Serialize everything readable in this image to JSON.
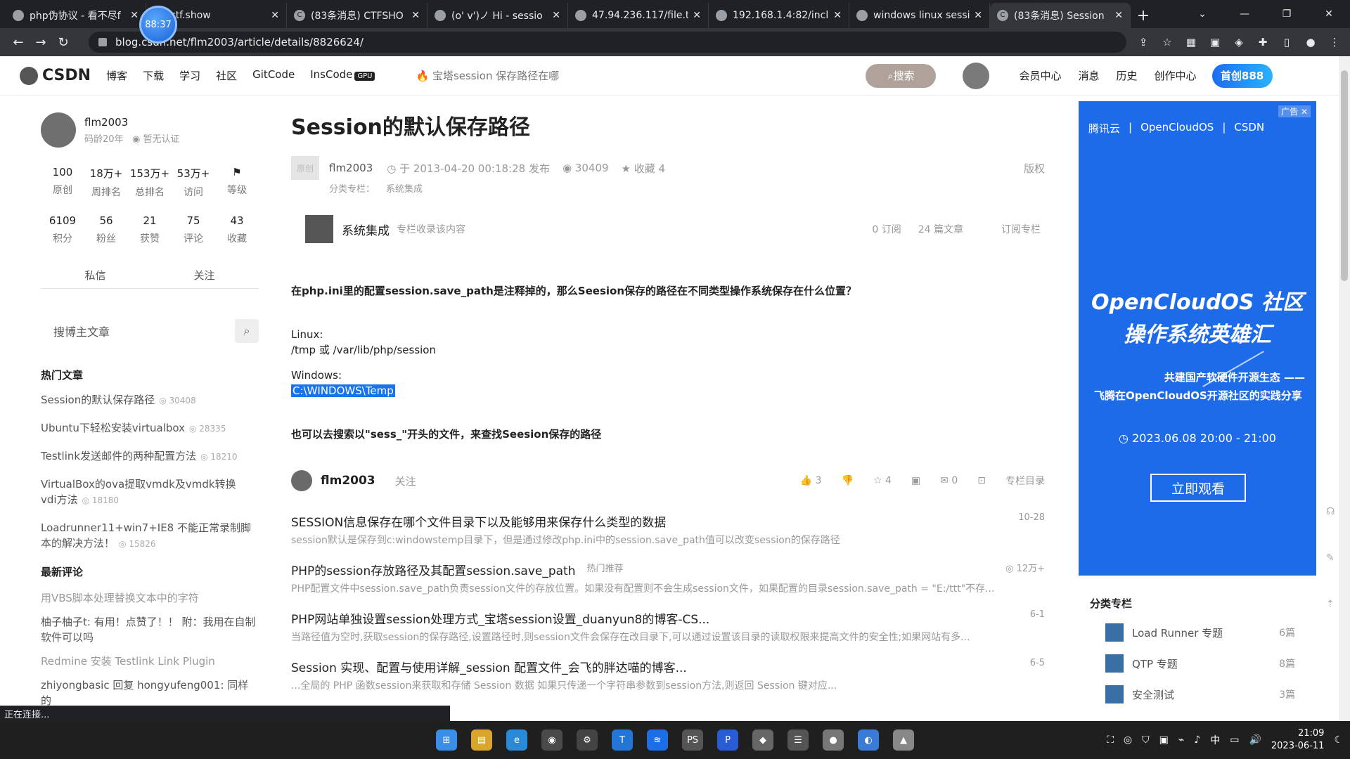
{
  "browser": {
    "tabs": [
      {
        "title": "php伪协议 - 看不尽f",
        "active": false
      },
      {
        "title": "ctf.show",
        "active": false
      },
      {
        "title": "(83条消息) CTFSHO",
        "active": false
      },
      {
        "title": "(o' v')ノ Hi - sessio",
        "active": false
      },
      {
        "title": "47.94.236.117/file.t",
        "active": false
      },
      {
        "title": "192.168.1.4:82/inclu",
        "active": false
      },
      {
        "title": "windows linux sessi",
        "active": false
      },
      {
        "title": "(83条消息) Session",
        "active": true
      }
    ],
    "timer": "88:37",
    "url": "blog.csdn.net/flm2003/article/details/8826624/",
    "status_text": "正在连接..."
  },
  "header": {
    "logo": "CSDN",
    "nav": [
      "博客",
      "下载",
      "学习",
      "社区",
      "GitCode",
      "InsCode"
    ],
    "gpu_badge": "GPU",
    "hot_search": "宝塔session 保存路径在哪",
    "search_label": "搜索",
    "links": [
      "会员中心",
      "消息",
      "历史",
      "创作中心"
    ],
    "vip_label": "首创888"
  },
  "sidebar": {
    "author_name": "flm2003",
    "author_years": "码龄20年",
    "author_cert": "暂无认证",
    "stats": [
      {
        "num": "100",
        "label": "原创"
      },
      {
        "num": "18万+",
        "label": "周排名"
      },
      {
        "num": "153万+",
        "label": "总排名"
      },
      {
        "num": "53万+",
        "label": "访问"
      },
      {
        "num": "",
        "label": "等级"
      },
      {
        "num": "6109",
        "label": "积分"
      },
      {
        "num": "56",
        "label": "粉丝"
      },
      {
        "num": "21",
        "label": "获赞"
      },
      {
        "num": "75",
        "label": "评论"
      },
      {
        "num": "43",
        "label": "收藏"
      }
    ],
    "private_msg": "私信",
    "follow": "关注",
    "search_placeholder": "搜博主文章",
    "hot_heading": "热门文章",
    "hot_articles": [
      {
        "title": "Session的默认保存路径",
        "views": "30408"
      },
      {
        "title": "Ubuntu下轻松安装virtualbox",
        "views": "28335"
      },
      {
        "title": "Testlink发送邮件的两种配置方法",
        "views": "18210"
      },
      {
        "title": "VirtualBox的ova提取vmdk及vmdk转换vdi方法",
        "views": "18180"
      },
      {
        "title": "Loadrunner11+win7+IE8 不能正常录制脚本的解决方法！",
        "views": "15826"
      }
    ],
    "comments_heading": "最新评论",
    "comments": [
      {
        "text": "用VBS脚本处理替换文本中的字符",
        "dim": true
      },
      {
        "text": "柚子柚子t: 有用！点赞了！！ 附：我用在自制软件可以吗",
        "dim": false
      },
      {
        "text": "Redmine 安装 Testlink Link Plugin",
        "dim": true
      },
      {
        "text": "zhiyongbasic 回复 hongyufeng001: 同样的",
        "dim": false
      }
    ]
  },
  "article": {
    "title": "Session的默认保存路径",
    "original_badge": "原创",
    "author": "flm2003",
    "published": "于 2013-04-20 00:18:28 发布",
    "views": "30409",
    "favorites": "收藏 4",
    "copyright": "版权",
    "category_label": "分类专栏：",
    "category_tag": "系统集成",
    "column_name": "系统集成",
    "column_desc": "专栏收录该内容",
    "column_subs": "0 订阅",
    "column_count": "24 篇文章",
    "column_subscribe": "订阅专栏",
    "question": "在php.ini里的配置session.save_path是注释掉的，那么Seesion保存的路径在不同类型操作系统保存在什么位置？",
    "linux_label": "Linux:",
    "linux_path": "/tmp 或 /var/lib/php/session",
    "windows_label": "Windows:",
    "windows_path": "C:\\WINDOWS\\Temp",
    "tip": "也可以去搜索以\"sess_\"开头的文件，来查找Seesion保存的路径"
  },
  "actions": {
    "author": "flm2003",
    "follow": "关注",
    "likes": "3",
    "stars": "4",
    "comments": "0",
    "column_toc": "专栏目录"
  },
  "recommendations": [
    {
      "title": "SESSION信息保存在哪个文件目录下以及能够用来保存什么类型的数据",
      "date": "10-28",
      "tag": "",
      "desc": "session默认是保存到c:windowstemp目录下，但是通过修改php.ini中的session.save_path值可以改变session的保存路径"
    },
    {
      "title": "PHP的session存放路径及其配置session.save_path",
      "date": "12万+",
      "tag": "热门推荐",
      "desc": "PHP配置文件中session.save_path负责session文件的存放位置。如果没有配置则不会生成session文件，如果配置的目录session.save_path = \"E:/ttt\"不存..."
    },
    {
      "title": "PHP网站单独设置session处理方式_宝塔session设置_duanyun8的博客-CS...",
      "date": "6-1",
      "tag": "",
      "desc": "当路径值为空时,获取session的保存路径,设置路径时,则session文件会保存在改目录下,可以通过设置该目录的读取权限来提高文件的安全性;如果网站有多..."
    },
    {
      "title": "Session 实现、配置与使用详解_session 配置文件_会飞的胖达喵的博客...",
      "date": "6-5",
      "tag": "",
      "desc": "...全局的 PHP 函数session来获取和存储 Session 数据 如果只传递一个字符串参数到session方法,则返回 Session 键对应..."
    }
  ],
  "ad": {
    "tag": "广告",
    "logos": [
      "腾讯云",
      "OpenCloudOS",
      "CSDN"
    ],
    "title_line1": "OpenCloudOS 社区",
    "title_line2": "操作系统英雄汇",
    "sub_line1": "共建国产软硬件开源生态 ——",
    "sub_line2": "飞腾在OpenCloudOS开源社区的实践分享",
    "time": "2023.06.08  20:00 - 21:00",
    "button": "立即观看"
  },
  "categories": {
    "heading": "分类专栏",
    "items": [
      {
        "name": "Load Runner 专题",
        "count": "6篇"
      },
      {
        "name": "QTP 专题",
        "count": "8篇"
      },
      {
        "name": "安全测试",
        "count": "3篇"
      }
    ]
  },
  "taskbar": {
    "time": "21:09",
    "date": "2023-06-11",
    "ime": "中"
  }
}
